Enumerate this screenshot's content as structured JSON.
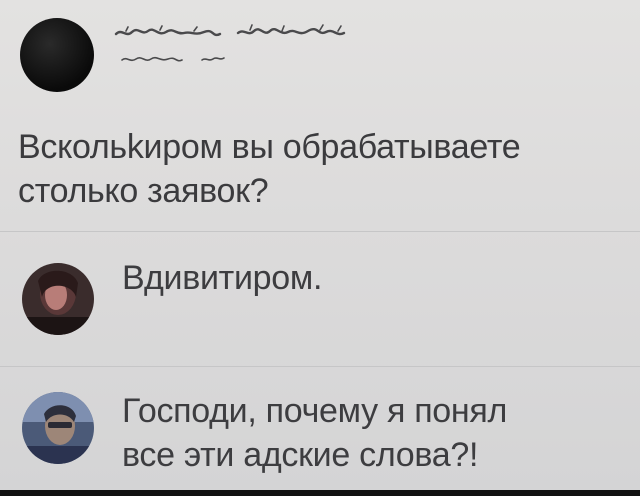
{
  "post": {
    "author_name": "[blurred name]",
    "author_meta": "[blurred time]",
    "text_line1": "Вскольkиром вы обрабатываете",
    "text_line2": "столько заявок?"
  },
  "comments": [
    {
      "text_line1": "Вдивитиром.",
      "text_line2": ""
    },
    {
      "text_line1": "Господи, почему я понял",
      "text_line2": "все эти адские слова?!"
    }
  ],
  "colors": {
    "background": "#dcdbdb",
    "text": "#3b3b3e",
    "divider": "#c6c6c7"
  }
}
